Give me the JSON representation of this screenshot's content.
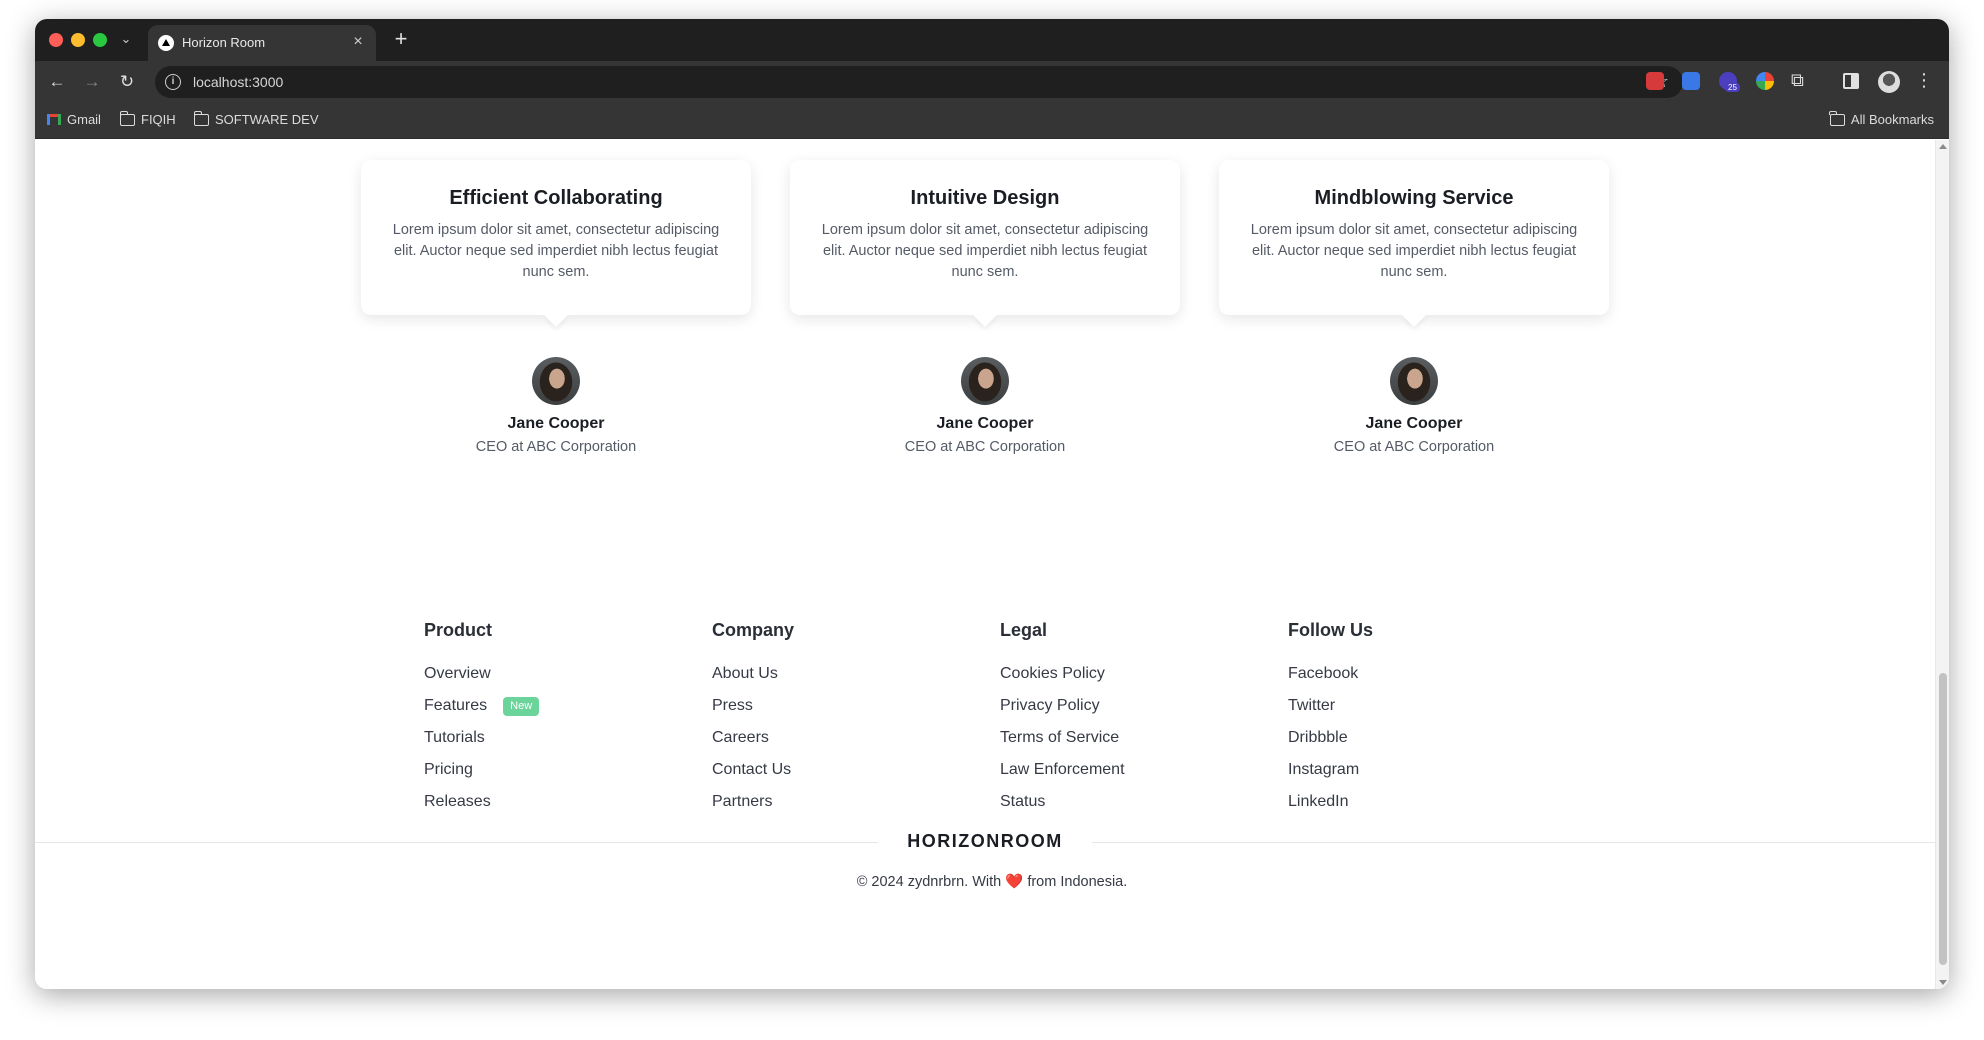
{
  "browser": {
    "tab_title": "Horizon Room",
    "url": "localhost:3000",
    "bookmarks": [
      "Gmail",
      "FIQIH",
      "SOFTWARE DEV"
    ],
    "all_bookmarks": "All Bookmarks",
    "extension_badge": "25"
  },
  "testimonials": [
    {
      "title": "Efficient Collaborating",
      "text": "Lorem ipsum dolor sit amet, consectetur adipiscing elit. Auctor neque sed imperdiet nibh lectus feugiat nunc sem.",
      "name": "Jane Cooper",
      "role": "CEO at ABC Corporation"
    },
    {
      "title": "Intuitive Design",
      "text": "Lorem ipsum dolor sit amet, consectetur adipiscing elit. Auctor neque sed imperdiet nibh lectus feugiat nunc sem.",
      "name": "Jane Cooper",
      "role": "CEO at ABC Corporation"
    },
    {
      "title": "Mindblowing Service",
      "text": "Lorem ipsum dolor sit amet, consectetur adipiscing elit. Auctor neque sed imperdiet nibh lectus feugiat nunc sem.",
      "name": "Jane Cooper",
      "role": "CEO at ABC Corporation"
    }
  ],
  "footer": {
    "columns": [
      {
        "title": "Product",
        "links": [
          "Overview",
          "Features",
          "Tutorials",
          "Pricing",
          "Releases"
        ]
      },
      {
        "title": "Company",
        "links": [
          "About Us",
          "Press",
          "Careers",
          "Contact Us",
          "Partners"
        ]
      },
      {
        "title": "Legal",
        "links": [
          "Cookies Policy",
          "Privacy Policy",
          "Terms of Service",
          "Law Enforcement",
          "Status"
        ]
      },
      {
        "title": "Follow Us",
        "links": [
          "Facebook",
          "Twitter",
          "Dribbble",
          "Instagram",
          "LinkedIn"
        ]
      }
    ],
    "new_badge": "New",
    "brand": "HORIZONROOM",
    "copyright_before": "© 2024 zydnrbrn. With",
    "copyright_after": "from Indonesia.",
    "heart": "❤️"
  },
  "colors": {
    "badge_new": "#6bd49a",
    "heart": "#e53935",
    "chrome_dark": "#353535"
  }
}
